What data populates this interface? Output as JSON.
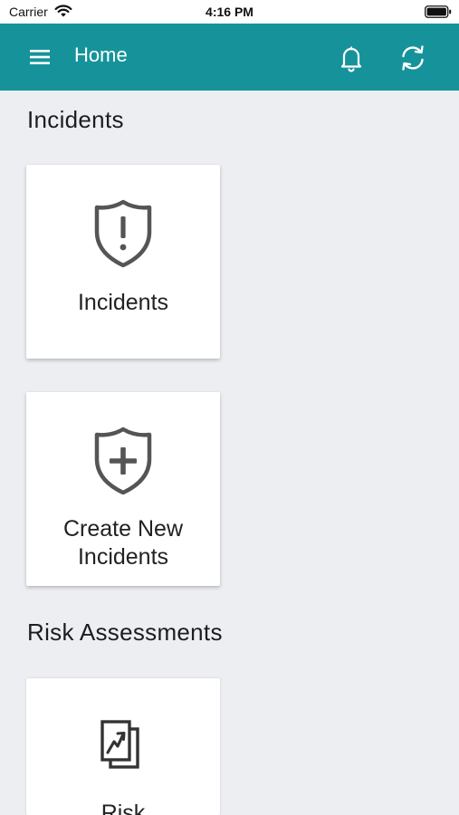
{
  "status_bar": {
    "carrier": "Carrier",
    "time": "4:16 PM"
  },
  "app_bar": {
    "title": "Home",
    "background_color": "#16939A"
  },
  "sections": {
    "incidents": {
      "title": "Incidents",
      "tiles": [
        {
          "label": "Incidents",
          "icon": "shield-exclamation-icon"
        },
        {
          "label_line1": "Create New",
          "label_line2": "Incidents",
          "icon": "shield-plus-icon"
        }
      ]
    },
    "risk_assessments": {
      "title": "Risk Assessments",
      "tiles": [
        {
          "label": "Risk",
          "icon": "risk-documents-icon"
        }
      ]
    }
  }
}
